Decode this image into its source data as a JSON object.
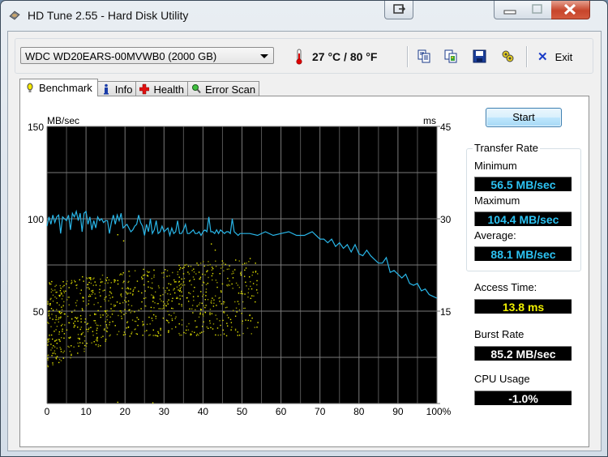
{
  "window": {
    "title": "HD Tune 2.55 - Hard Disk Utility"
  },
  "toolbar": {
    "drive": "WDC WD20EARS-00MVWB0 (2000 GB)",
    "temperature": "27 °C / 80 °F",
    "icons": [
      "copy-text-icon",
      "copy-screenshot-icon",
      "save-icon",
      "options-icon"
    ],
    "exit_label": "Exit"
  },
  "tabs": [
    {
      "label": "Benchmark",
      "icon": "benchmark-icon",
      "active": true
    },
    {
      "label": "Info",
      "icon": "info-icon",
      "active": false
    },
    {
      "label": "Health",
      "icon": "health-icon",
      "active": false
    },
    {
      "label": "Error Scan",
      "icon": "error-scan-icon",
      "active": false
    }
  ],
  "benchmark": {
    "start_label": "Start",
    "transfer_rate": {
      "title": "Transfer Rate",
      "minimum_label": "Minimum",
      "minimum": "56.5 MB/sec",
      "maximum_label": "Maximum",
      "maximum": "104.4 MB/sec",
      "average_label": "Average:",
      "average": "88.1 MB/sec"
    },
    "access_time_label": "Access Time:",
    "access_time": "13.8 ms",
    "burst_rate_label": "Burst Rate",
    "burst_rate": "85.2 MB/sec",
    "cpu_usage_label": "CPU Usage",
    "cpu_usage": "-1.0%",
    "colors": {
      "transfer_line": "#29b6e8",
      "access_points": "#e8e800",
      "plot_bg": "#000000",
      "grid": "#707070"
    }
  },
  "chart_data": {
    "type": "line",
    "title": "",
    "xlabel": "",
    "ylabel": "MB/sec",
    "y2label": "ms",
    "xlim": [
      0,
      100
    ],
    "ylim": [
      0,
      150
    ],
    "y2lim": [
      0,
      45
    ],
    "x_ticks": [
      "0",
      "10",
      "20",
      "30",
      "40",
      "50",
      "60",
      "70",
      "80",
      "90",
      "100%"
    ],
    "y_ticks": [
      "150",
      "100",
      "50"
    ],
    "y2_ticks": [
      "45",
      "30",
      "15"
    ],
    "grid": true,
    "series": [
      {
        "name": "Transfer Rate (MB/sec)",
        "axis": "left",
        "x": [
          0,
          0.5,
          1,
          1.5,
          2,
          2.5,
          3,
          3.5,
          4,
          4.5,
          5,
          5.5,
          6,
          6.5,
          7,
          7.5,
          8,
          8.5,
          9,
          9.5,
          10,
          10.5,
          11,
          11.5,
          12,
          12.5,
          13,
          13.5,
          14,
          14.5,
          15,
          15.5,
          16,
          16.5,
          17,
          17.5,
          18,
          18.5,
          19,
          19.5,
          20,
          20.5,
          21,
          21.5,
          22,
          22.5,
          23,
          23.5,
          24,
          24.5,
          25,
          25.5,
          26,
          26.5,
          27,
          27.5,
          28,
          28.5,
          29,
          29.5,
          30,
          30.5,
          31,
          31.5,
          32,
          32.5,
          33,
          33.5,
          34,
          34.5,
          35,
          35.5,
          36,
          36.5,
          37,
          37.5,
          38,
          38.5,
          39,
          39.5,
          40,
          40.5,
          41,
          41.5,
          42,
          42.5,
          43,
          43.5,
          44,
          44.5,
          45,
          45.5,
          46,
          46.5,
          47,
          47.5,
          48,
          48.5,
          49,
          49.5,
          50,
          52,
          54,
          56,
          58,
          60,
          62,
          64,
          66,
          68,
          70,
          71,
          72,
          73,
          74,
          75,
          76,
          77,
          78,
          79,
          80,
          81,
          82,
          83,
          84,
          85,
          86,
          87,
          88,
          89,
          90,
          91,
          92,
          93,
          94,
          95,
          96,
          97,
          98,
          99,
          100
        ],
        "y": [
          96,
          101,
          97,
          102,
          98,
          101,
          102,
          92,
          101,
          100,
          99,
          102,
          94,
          103,
          101,
          104,
          99,
          103,
          93,
          103,
          104,
          97,
          101,
          94,
          99,
          95,
          101,
          99,
          100,
          98,
          99,
          99,
          92,
          98,
          102,
          97,
          102,
          99,
          103,
          95,
          96,
          97,
          95,
          93,
          94,
          96,
          97,
          102,
          98,
          96,
          91,
          97,
          93,
          100,
          92,
          94,
          99,
          92,
          93,
          96,
          93,
          94,
          95,
          91,
          95,
          92,
          93,
          99,
          92,
          92,
          94,
          97,
          92,
          92,
          93,
          94,
          92,
          92,
          93,
          91,
          93,
          94,
          93,
          101,
          93,
          93,
          92,
          94,
          92,
          94,
          93,
          92,
          93,
          93,
          92,
          100,
          93,
          92,
          91,
          92,
          92,
          92,
          91,
          93,
          91,
          92,
          93,
          91,
          91,
          93,
          89,
          89,
          87,
          89,
          85,
          87,
          84,
          86,
          82,
          86,
          81,
          80,
          83,
          80,
          78,
          76,
          76,
          79,
          71,
          72,
          70,
          68,
          70,
          65,
          64,
          65,
          61,
          62,
          59,
          58,
          57
        ]
      },
      {
        "name": "Access Time (ms)",
        "axis": "right",
        "type": "scatter",
        "note": "scatter of access times roughly 5–28 ms, denser at 0–45% position"
      }
    ]
  }
}
